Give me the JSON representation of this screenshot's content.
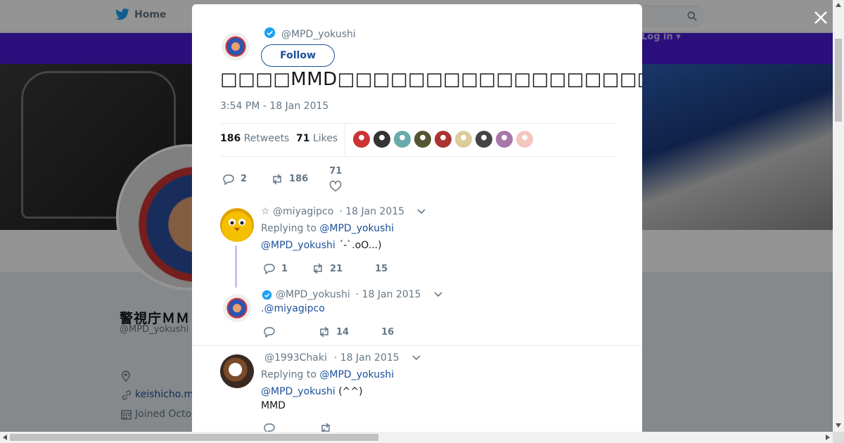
{
  "nav": {
    "home_label": "Home",
    "login_label": "Log in"
  },
  "profile": {
    "name": "警視庁ＭＭＤ部",
    "handle": "@MPD_yokushi",
    "link": "keishicho.m",
    "joined": "Joined Octo"
  },
  "tweet": {
    "handle": "@MPD_yokushi",
    "follow_label": "Follow",
    "text": "□□□□MMD□□□□□□□□□□□□□□□□□□□MMD□□□□□□□□□□□□□□□□□□□□□□□",
    "time": "3:54 PM - 18 Jan 2015",
    "retweets_count": "186",
    "retweets_label": "Retweets",
    "likes_count": "71",
    "likes_label": "Likes",
    "reply_count": "2",
    "retweet_count": "186",
    "like_count": "71",
    "liker_colors": [
      "#c33",
      "#333",
      "#6aa",
      "#553",
      "#a33",
      "#dc9",
      "#444",
      "#a7a",
      "#f3c6c0"
    ]
  },
  "replies": [
    {
      "name": "☆ @miyagipco",
      "date": "· 18 Jan 2015",
      "replying_prefix": "Replying to",
      "replying_to": "@MPD_yokushi",
      "mention": "@MPD_yokushi",
      "text": "´-`.oO...)",
      "reply_count": "1",
      "retweet_count": "21",
      "like_count": "15"
    },
    {
      "name": "@MPD_yokushi",
      "date": "· 18 Jan 2015",
      "text": ".@miyagipco",
      "reply_count": "",
      "retweet_count": "14",
      "like_count": "16"
    },
    {
      "name": "@1993Chaki",
      "date": "· 18 Jan 2015",
      "replying_prefix": "Replying to",
      "replying_to": "@MPD_yokushi",
      "mention": "@MPD_yokushi",
      "text": "(^^)",
      "text2": "MMD"
    }
  ],
  "colors": {
    "accent": "#1b4f9b",
    "verified": "#1da1f2",
    "purple": "#4a1bd6"
  }
}
